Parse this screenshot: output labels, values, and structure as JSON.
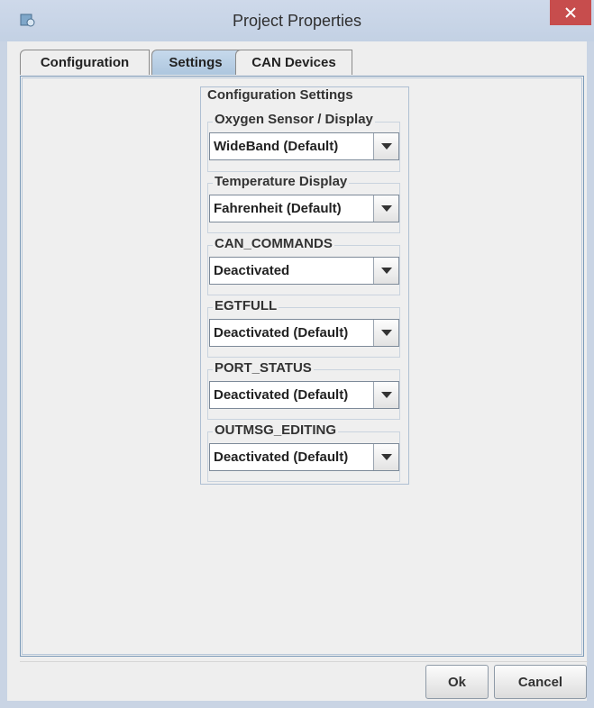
{
  "window": {
    "title": "Project Properties",
    "icon": "project-icon",
    "close_icon": "close-icon"
  },
  "tabs": [
    {
      "label": "Configuration",
      "active": false
    },
    {
      "label": "Settings",
      "active": true
    },
    {
      "label": "CAN Devices",
      "active": false
    }
  ],
  "settings": {
    "title": "Configuration Settings",
    "groups": [
      {
        "label": "Oxygen Sensor / Display",
        "value": "WideBand (Default)"
      },
      {
        "label": "Temperature Display",
        "value": "Fahrenheit (Default)"
      },
      {
        "label": "CAN_COMMANDS",
        "value": "Deactivated"
      },
      {
        "label": "EGTFULL",
        "value": "Deactivated (Default)"
      },
      {
        "label": "PORT_STATUS",
        "value": "Deactivated (Default)"
      },
      {
        "label": "OUTMSG_EDITING",
        "value": "Deactivated (Default)"
      }
    ]
  },
  "buttons": {
    "ok": "Ok",
    "cancel": "Cancel"
  },
  "colors": {
    "active_tab": "#b8cfe5",
    "close_button": "#c74d4d",
    "titlebar": "#c8d6e8"
  }
}
